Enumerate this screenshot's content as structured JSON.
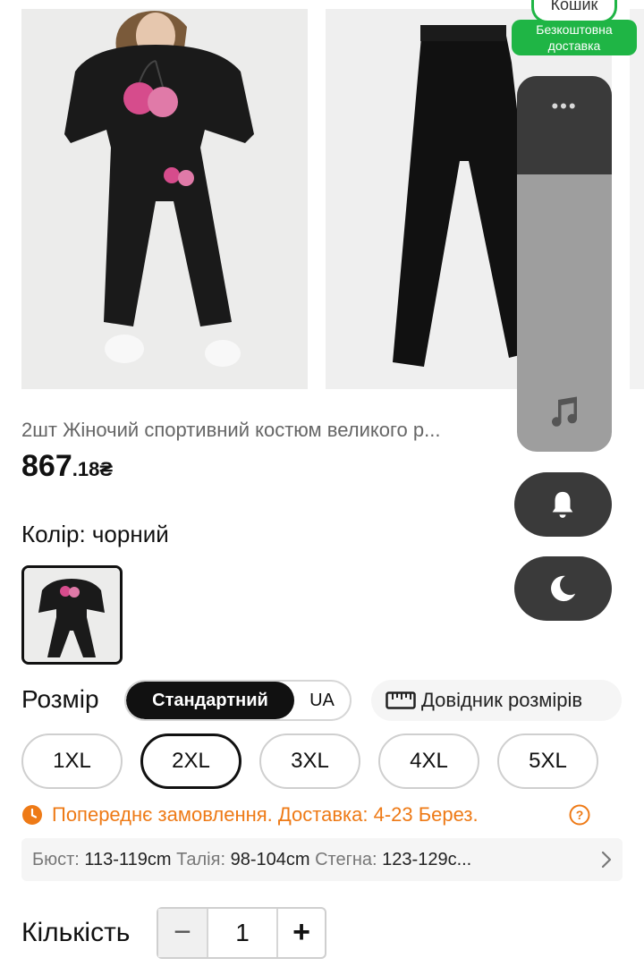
{
  "cart": {
    "label": "Кошик",
    "free_shipping": "Безкоштовна доставка"
  },
  "product": {
    "title": "2шт Жіночий спортивний костюм великого р...",
    "price_main": "867",
    "price_cents": ".18₴"
  },
  "color": {
    "label": "Колір: чорний",
    "selected": "чорний"
  },
  "size": {
    "label": "Розмір",
    "toggle_active": "Стандартний",
    "toggle_other": "UA",
    "guide_label": "Довідник розмірів",
    "options": [
      "1XL",
      "2XL",
      "3XL",
      "4XL",
      "5XL"
    ],
    "selected": "2XL"
  },
  "preorder": {
    "text": "Попереднє замовлення. Доставка: 4-23 Берез."
  },
  "measurements": {
    "bust_key": "Бюст:",
    "bust_val": "113-119cm",
    "waist_key": "Талія:",
    "waist_val": "98-104cm",
    "hips_key": "Стегна:",
    "hips_val": "123-129c..."
  },
  "quantity": {
    "label": "Кількість",
    "minus": "−",
    "value": "1",
    "plus": "+"
  },
  "overlay": {
    "more_label": "•••"
  },
  "icons": {
    "cart": "cart-label",
    "music": "music-icon",
    "bell": "bell-icon",
    "moon": "moon-icon",
    "ruler": "ruler-icon",
    "clock": "clock-icon",
    "help": "help-icon",
    "chevron": "chevron-right-icon"
  },
  "colors": {
    "accent_green": "#1fb545",
    "warning_orange": "#ee7a16",
    "dark_panel": "#3a3a3a"
  }
}
